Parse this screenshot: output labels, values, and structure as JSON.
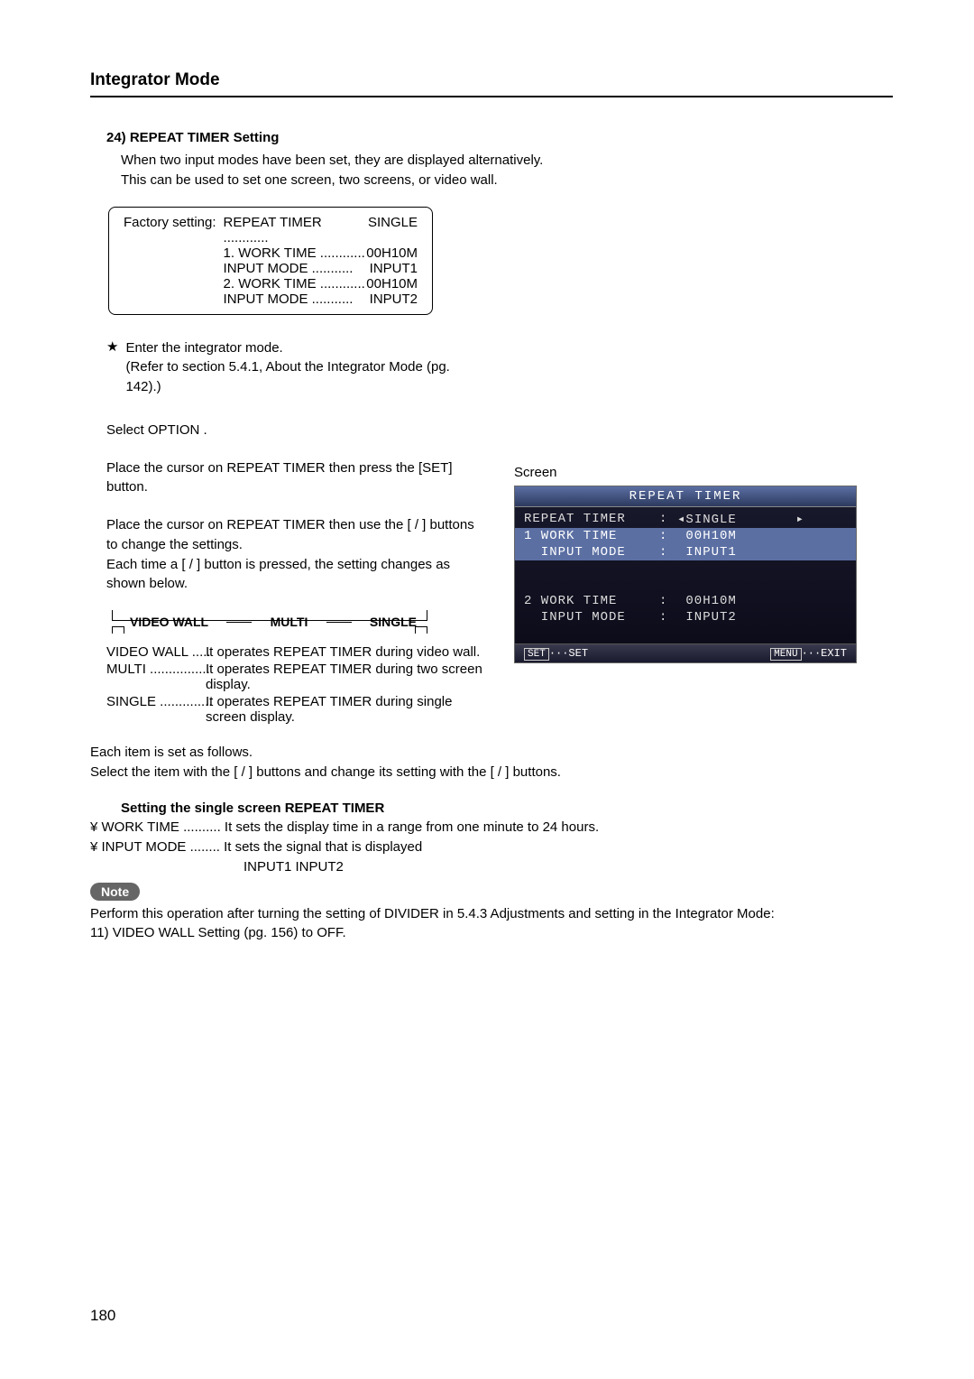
{
  "header": {
    "title": "Integrator Mode"
  },
  "section": {
    "heading": "24) REPEAT TIMER Setting",
    "intro1": "When two input modes have been set, they are displayed alternatively.",
    "intro2": "This can be used to set one screen, two screens, or video wall."
  },
  "factory": {
    "label": "Factory setting:",
    "rows": [
      {
        "k": "REPEAT TIMER ............",
        "v": "SINGLE"
      },
      {
        "k": "1. WORK TIME ............",
        "v": "00H10M"
      },
      {
        "k": "    INPUT MODE ...........",
        "v": "INPUT1"
      },
      {
        "k": "2. WORK TIME ............",
        "v": "00H10M"
      },
      {
        "k": "    INPUT MODE ...........",
        "v": "INPUT2"
      }
    ]
  },
  "steps": {
    "s1a": "Enter the integrator mode.",
    "s1b": "(Refer to section 5.4.1,   About the Integrator Mode   (pg. 142).)",
    "s2": "Select  OPTION .",
    "s3": "Place the cursor on  REPEAT TIMER then press the [SET] button.",
    "s4a": "Place the cursor on  REPEAT TIMER  then use the [   /   ] buttons to change the settings.",
    "s4b": "Each time a [   /   ] button is pressed, the setting changes as shown below."
  },
  "cycle": {
    "a": "VIDEO WALL",
    "b": "MULTI",
    "c": "SINGLE"
  },
  "desc": [
    {
      "k": "VIDEO WALL .....",
      "v": "It operates REPEAT TIMER during video wall."
    },
    {
      "k": "MULTI ................",
      "v": "It operates REPEAT TIMER during two screen display."
    },
    {
      "k": "SINGLE ..............",
      "v": "It operates REPEAT TIMER during single screen display."
    }
  ],
  "followup": {
    "p1": "Each item is set as follows.",
    "p2": "Select the item with the [   /   ] buttons and change its setting with the [   /   ] buttons.",
    "sub": "Setting the single screen REPEAT TIMER",
    "w1": "¥ WORK TIME .......... It sets the display time in a range from one minute to 24 hours.",
    "w2": "¥ INPUT MODE ........ It sets the signal that is displayed",
    "w3": "INPUT1    INPUT2"
  },
  "note": {
    "label": "Note",
    "text1": "Perform this operation after turning the setting of DIVIDER in   5.4.3 Adjustments and setting in the Integrator Mode:",
    "text2": "11) VIDEO WALL Setting (pg. 156)  to OFF."
  },
  "screen": {
    "label": "Screen",
    "title": "REPEAT TIMER",
    "rows": [
      {
        "hl": false,
        "k": "REPEAT TIMER",
        "sep": ":",
        "v": "◂SINGLE       ▸"
      },
      {
        "hl": true,
        "k": "1 WORK TIME",
        "sep": ":",
        "v": " 00H10M"
      },
      {
        "hl": true,
        "k": "  INPUT MODE",
        "sep": ":",
        "v": " INPUT1"
      },
      {
        "hl": false,
        "k": "",
        "sep": "",
        "v": ""
      },
      {
        "hl": false,
        "k": "",
        "sep": "",
        "v": ""
      },
      {
        "hl": false,
        "k": "2 WORK TIME",
        "sep": ":",
        "v": " 00H10M"
      },
      {
        "hl": false,
        "k": "  INPUT MODE",
        "sep": ":",
        "v": " INPUT2"
      },
      {
        "hl": false,
        "k": "",
        "sep": "",
        "v": ""
      }
    ],
    "footer_left_btn": "SET",
    "footer_left": "···SET",
    "footer_right_btn": "MENU",
    "footer_right": "···EXIT"
  },
  "page_number": "180"
}
